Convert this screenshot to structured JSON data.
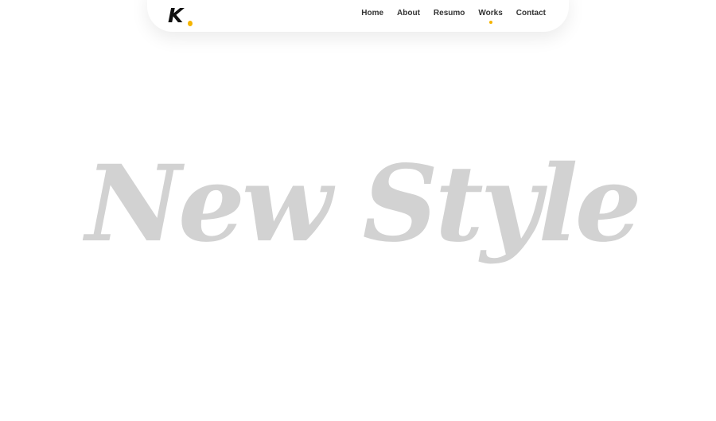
{
  "header": {
    "logo": {
      "letter": "K",
      "accent_color": "#f5b400"
    },
    "nav": {
      "items": [
        {
          "label": "Home",
          "active": false
        },
        {
          "label": "About",
          "active": false
        },
        {
          "label": "Resumo",
          "active": false
        },
        {
          "label": "Works",
          "active": true
        },
        {
          "label": "Contact",
          "active": false
        }
      ]
    }
  },
  "hero": {
    "title": "New Style",
    "title_color": "#d2d2d2"
  }
}
